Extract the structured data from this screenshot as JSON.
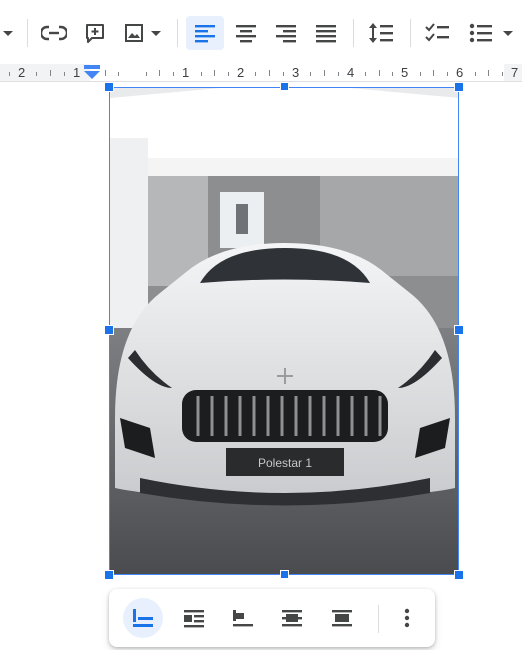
{
  "toolbar": {
    "buttons": [
      {
        "name": "dropdown-arrow",
        "icon": "chevron-down-icon"
      },
      {
        "name": "insert-link",
        "icon": "link-icon"
      },
      {
        "name": "add-comment",
        "icon": "add-comment-icon"
      },
      {
        "name": "insert-image",
        "icon": "image-icon"
      },
      {
        "name": "align-left",
        "icon": "align-left-icon",
        "active": true
      },
      {
        "name": "align-center",
        "icon": "align-center-icon"
      },
      {
        "name": "align-right",
        "icon": "align-right-icon"
      },
      {
        "name": "align-justify",
        "icon": "align-justify-icon"
      },
      {
        "name": "line-spacing",
        "icon": "line-spacing-icon"
      },
      {
        "name": "checklist",
        "icon": "checklist-icon"
      },
      {
        "name": "bulleted-list",
        "icon": "bulleted-list-icon"
      }
    ]
  },
  "ruler": {
    "labels": [
      "2",
      "1",
      "1",
      "2",
      "3",
      "4",
      "5",
      "6",
      "7"
    ]
  },
  "image": {
    "plate_text": "Polestar 1"
  },
  "wrap_bar": {
    "options": [
      {
        "name": "in-line",
        "icon": "wrap-inline-icon",
        "active": true
      },
      {
        "name": "wrap-text",
        "icon": "wrap-text-icon"
      },
      {
        "name": "break-text",
        "icon": "break-text-icon"
      },
      {
        "name": "behind-text",
        "icon": "behind-text-icon"
      },
      {
        "name": "in-front-of-text",
        "icon": "in-front-of-text-icon"
      }
    ],
    "more_icon": "more-vert-icon"
  },
  "colors": {
    "accent": "#1a73e8",
    "active_bg": "#e8f0fe",
    "icon": "#444746",
    "selection_border": "#4285f4"
  }
}
